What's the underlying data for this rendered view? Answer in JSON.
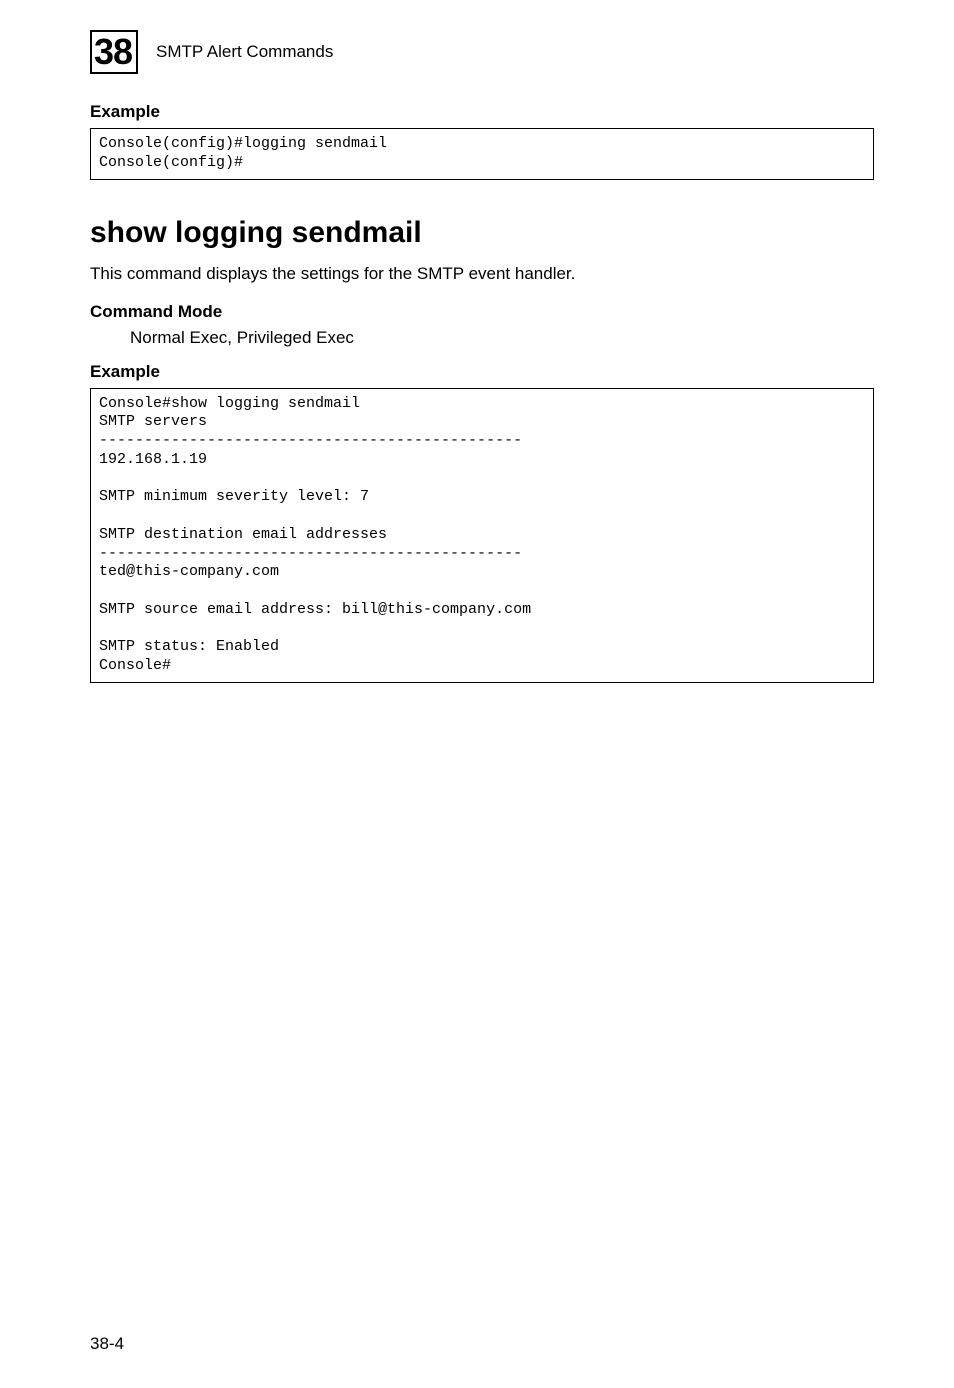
{
  "header": {
    "chapter_number": "38",
    "chapter_title": "SMTP Alert Commands"
  },
  "example1": {
    "label": "Example",
    "code": "Console(config)#logging sendmail\nConsole(config)#"
  },
  "section": {
    "heading": "show logging sendmail",
    "description": "This command displays the settings for the SMTP event handler.",
    "command_mode_label": "Command Mode",
    "command_mode_value": "Normal Exec, Privileged Exec"
  },
  "example2": {
    "label": "Example",
    "code": "Console#show logging sendmail\nSMTP servers\n-----------------------------------------------\n192.168.1.19\n\nSMTP minimum severity level: 7\n\nSMTP destination email addresses\n-----------------------------------------------\nted@this-company.com\n\nSMTP source email address: bill@this-company.com\n\nSMTP status: Enabled\nConsole#"
  },
  "page_number": "38-4"
}
